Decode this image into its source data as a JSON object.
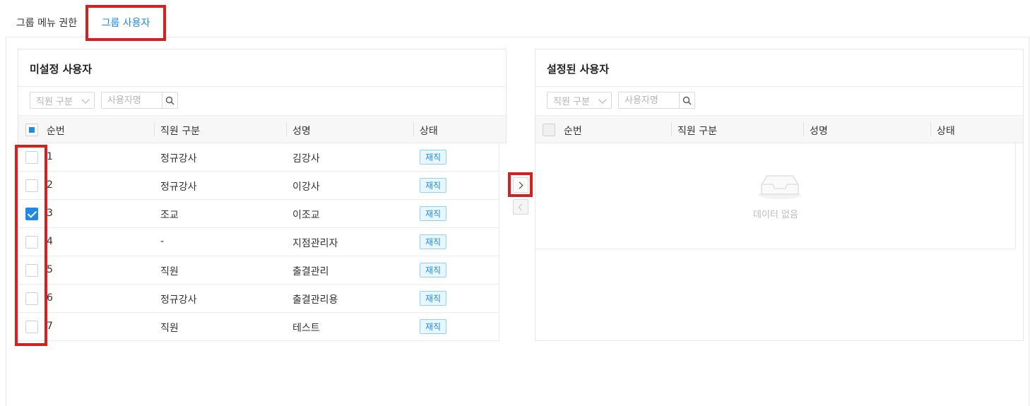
{
  "tabs": [
    {
      "label": "그룹 메뉴 권한"
    },
    {
      "label": "그룹 사용자"
    }
  ],
  "left_panel": {
    "title": "미설정 사용자",
    "filter": {
      "select_placeholder": "직원 구분",
      "search_placeholder": "사용자명"
    },
    "columns": [
      "순번",
      "직원 구분",
      "성명",
      "상태"
    ],
    "rows": [
      {
        "no": "1",
        "type": "정규강사",
        "name": "김강사",
        "status": "재직",
        "checked": false
      },
      {
        "no": "2",
        "type": "정규강사",
        "name": "이강사",
        "status": "재직",
        "checked": false
      },
      {
        "no": "3",
        "type": "조교",
        "name": "이조교",
        "status": "재직",
        "checked": true
      },
      {
        "no": "4",
        "type": "-",
        "name": "지점관리자",
        "status": "재직",
        "checked": false
      },
      {
        "no": "5",
        "type": "직원",
        "name": "출결관리",
        "status": "재직",
        "checked": false
      },
      {
        "no": "6",
        "type": "정규강사",
        "name": "출결관리용",
        "status": "재직",
        "checked": false
      },
      {
        "no": "7",
        "type": "직원",
        "name": "테스트",
        "status": "재직",
        "checked": false
      }
    ]
  },
  "right_panel": {
    "title": "설정된 사용자",
    "filter": {
      "select_placeholder": "직원 구분",
      "search_placeholder": "사용자명"
    },
    "columns": [
      "순번",
      "직원 구분",
      "성명",
      "상태"
    ],
    "empty_text": "데이터 없음"
  },
  "colors": {
    "accent": "#1e8ae6",
    "highlight": "#d81e1e",
    "badge_bg": "#e8f6fe",
    "badge_border": "#91d0f5"
  }
}
